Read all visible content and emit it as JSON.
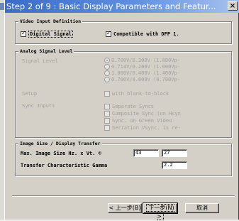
{
  "window": {
    "title": "Step 2 of 9 : Basic Display Parameters and Featur...",
    "close_label": "×"
  },
  "video_input": {
    "legend": "Video Input Definition",
    "digital_signal": {
      "label": "Digital Signal",
      "checked": true
    },
    "dfp_compatible": {
      "label": "Compatible with DFP 1.",
      "checked": true
    }
  },
  "analog_signal": {
    "legend": "Analog Signal Level",
    "signal_level_label": "Signal Level",
    "signal_level_options": [
      {
        "label": "0.700V/0.300V (1.000Vp-",
        "selected": true
      },
      {
        "label": "0.714V/0.286V (1.000Vp-",
        "selected": false
      },
      {
        "label": "1.000V/0.400V (1.400Vp-",
        "selected": false
      },
      {
        "label": "0.700V/0.000V (0.700Vp-",
        "selected": false
      }
    ],
    "setup_label": "Setup",
    "setup_option": {
      "label": "with blank-to-black",
      "checked": false
    },
    "sync_inputs_label": "Sync Inputs",
    "sync_options": [
      {
        "label": "Separate Syncs",
        "checked": false
      },
      {
        "label": "Composite Sync (on Hsyn",
        "checked": false
      },
      {
        "label": "Sync. on Green Video",
        "checked": false
      },
      {
        "label": "Serration Vsync. is re-",
        "checked": false
      }
    ]
  },
  "image_size": {
    "legend": "Image Size / Display Transfer",
    "max_size_label": "Max. Image Size  Hz. x  Vt. ©",
    "max_size_h": "43",
    "max_size_v": "27",
    "transfer_label": "Transfer Characteristic Gamma",
    "gamma_value": "2.2"
  },
  "buttons": {
    "back": "< 上一步(B)",
    "next": "下一步(N) >",
    "cancel": "取消"
  },
  "colors": {
    "title_gradient_start": "#3a6cc8",
    "title_gradient_end": "#a8c2ee",
    "dialog_face": "#d4d0c8",
    "disabled_text": "#a0a0a0"
  },
  "icons": {
    "close": "close-icon",
    "checkmark": "checkmark-icon"
  }
}
